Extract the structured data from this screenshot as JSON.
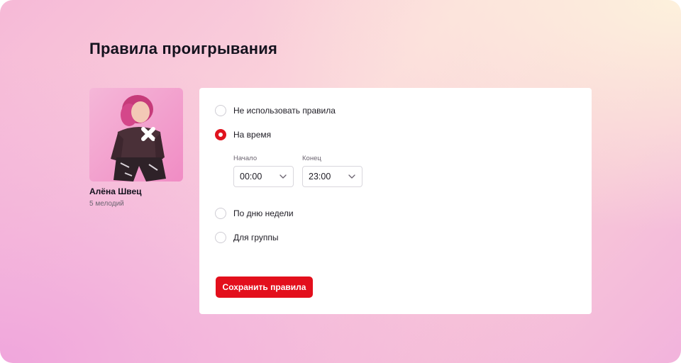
{
  "page": {
    "title": "Правила проигрывания"
  },
  "artist": {
    "name": "Алёна Швец",
    "tracks": "5 мелодий"
  },
  "rules": {
    "selected": "time",
    "options": [
      {
        "id": "none",
        "label": "Не использовать правила",
        "checked": false
      },
      {
        "id": "time",
        "label": "На время",
        "checked": true
      },
      {
        "id": "weekday",
        "label": "По дню недели",
        "checked": false
      },
      {
        "id": "group",
        "label": "Для группы",
        "checked": false
      }
    ],
    "time": {
      "start_label": "Начало",
      "start_value": "00:00",
      "end_label": "Конец",
      "end_value": "23:00"
    }
  },
  "actions": {
    "save_label": "Сохранить правила"
  },
  "colors": {
    "accent": "#e30f1c",
    "text": "#14121e",
    "muted": "#6b6470",
    "card": "#ffffff"
  },
  "icons": {
    "select_arrow": "chevron-down-icon"
  }
}
